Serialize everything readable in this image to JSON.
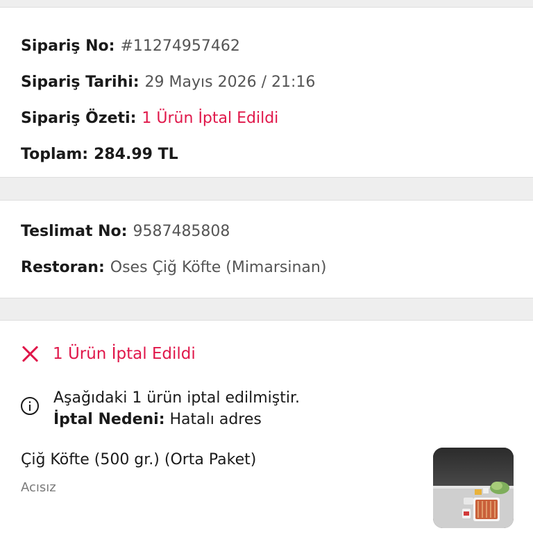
{
  "order": {
    "no_label": "Sipariş No:",
    "no_value": "#11274957462",
    "date_label": "Sipariş Tarihi:",
    "date_value": "29 Mayıs 2026 / 21:16",
    "summary_label": "Sipariş Özeti:",
    "summary_value": "1 Ürün İptal Edildi",
    "total_label": "Toplam:",
    "total_value": "284.99 TL"
  },
  "delivery": {
    "no_label": "Teslimat No:",
    "no_value": "9587485808",
    "restaurant_label": "Restoran:",
    "restaurant_value": "Oses Çiğ Köfte (Mimarsinan)"
  },
  "cancellation": {
    "title": "1 Ürün İptal Edildi",
    "info_line1": "Aşağıdaki 1 ürün iptal edilmiştir.",
    "reason_label": "İptal Nedeni:",
    "reason_value": "Hatalı adres",
    "product_name": "Çiğ Köfte (500 gr.) (Orta Paket)",
    "product_variant": "Acısız"
  },
  "colors": {
    "accent_red": "#e0174a",
    "background": "#eeeeee"
  },
  "icons": [
    "close-icon",
    "info-icon"
  ]
}
